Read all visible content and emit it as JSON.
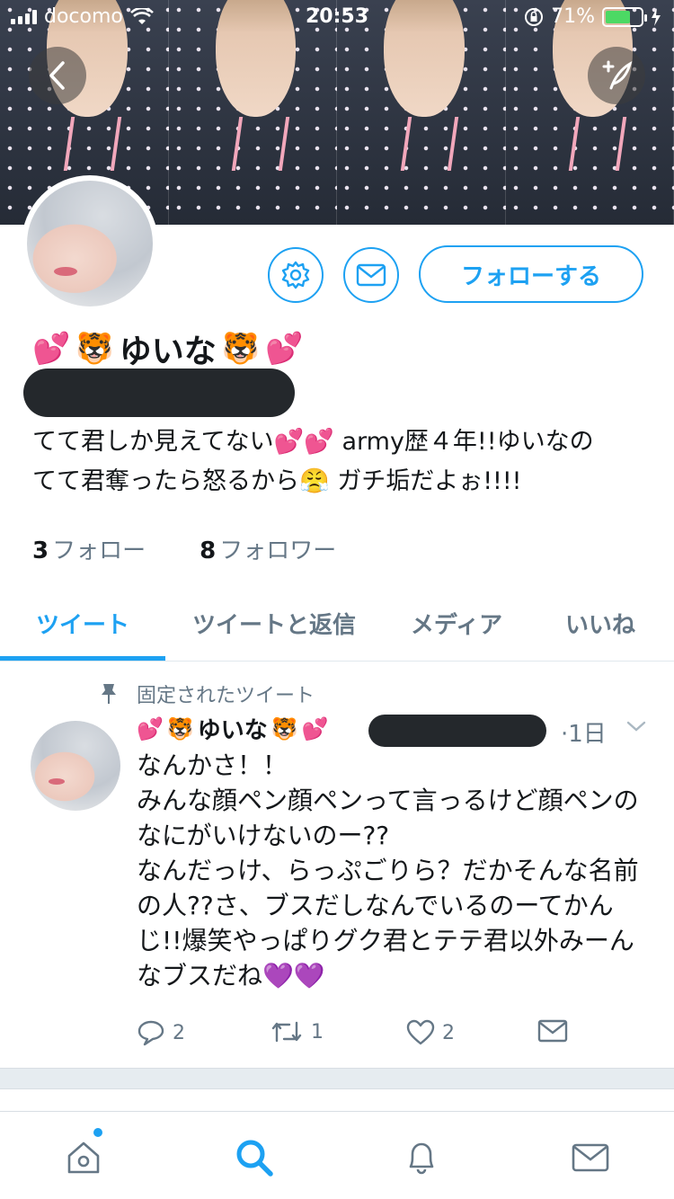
{
  "status_bar": {
    "carrier": "docomo",
    "time": "20:53",
    "battery_percent": "71%",
    "battery_level": 0.71
  },
  "profile": {
    "name": "ゆいな",
    "name_emoji": {
      "hearts": "💕",
      "tiger": "🐯"
    },
    "follow_label": "フォローする",
    "bio_line1": "てて君しか見えてない💕💕 army歴４年!!ゆいなの",
    "bio_line2": "てて君奪ったら怒るから😤 ガチ垢だよぉ!!!!",
    "stats": [
      {
        "num": "3",
        "label": "フォロー"
      },
      {
        "num": "8",
        "label": "フォロワー"
      }
    ]
  },
  "tabs": [
    "ツイート",
    "ツイートと返信",
    "メディア",
    "いいね"
  ],
  "active_tab": 0,
  "tweet": {
    "pinned_label": "固定されたツイート",
    "author": "ゆいな",
    "time": "·1日",
    "body": "なんかさ！！\nみんな顔ペン顔ペンって言っるけど顔ペンのなにがいけないのー??\nなんだっけ、らっぷごりら？だかそんな名前の人??さ、ブスだしなんでいるのーてかんじ!!爆笑やっぱりグク君とテテ君以外みーんなブスだね💜💜",
    "replies": "2",
    "retweets": "1",
    "likes": "2"
  },
  "icons": {
    "back": "back-chevron-icon",
    "compose": "compose-tweet-icon",
    "gear": "gear-icon",
    "dm": "envelope-icon",
    "pin": "pin-icon",
    "reply": "reply-icon",
    "retweet": "retweet-icon",
    "like": "heart-icon",
    "share": "envelope-share-icon",
    "home": "home-icon",
    "search": "search-icon",
    "notifications": "bell-icon",
    "messages": "mail-icon"
  },
  "colors": {
    "accent": "#1da1f2",
    "muted": "#657786",
    "text": "#14171a"
  }
}
